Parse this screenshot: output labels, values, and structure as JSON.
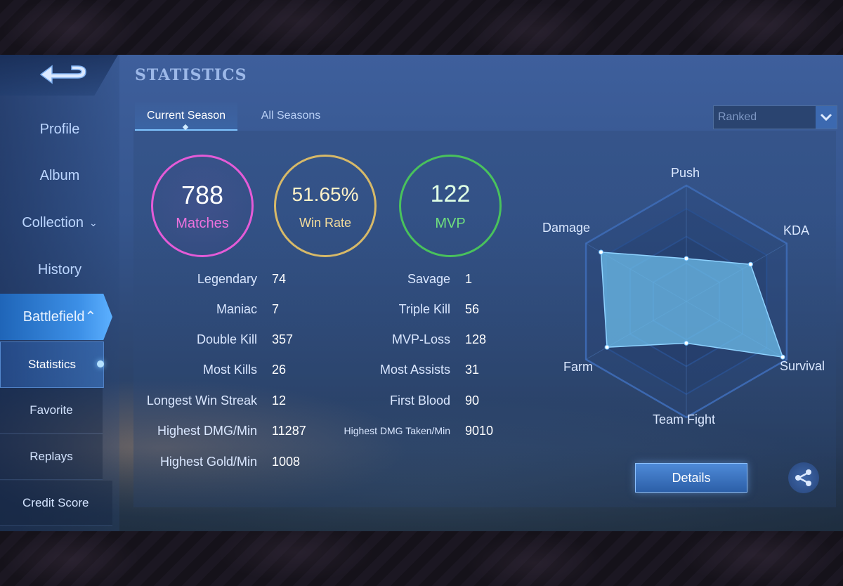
{
  "header": {
    "title": "STATISTICS"
  },
  "sidebar": {
    "items": [
      {
        "label": "Profile"
      },
      {
        "label": "Album"
      },
      {
        "label": "Collection"
      },
      {
        "label": "History"
      },
      {
        "label": "Battlefield"
      }
    ],
    "sub_items": [
      {
        "label": "Statistics"
      },
      {
        "label": "Favorite"
      },
      {
        "label": "Replays"
      },
      {
        "label": "Credit Score"
      }
    ]
  },
  "tabs": {
    "current": "Current Season",
    "all": "All Seasons"
  },
  "mode_select": {
    "value": "Ranked"
  },
  "summary": {
    "matches": {
      "value": "788",
      "label": "Matches"
    },
    "win_rate": {
      "value": "51.65%",
      "label": "Win Rate"
    },
    "mvp": {
      "value": "122",
      "label": "MVP"
    }
  },
  "stats_left": [
    {
      "label": "Legendary",
      "value": "74"
    },
    {
      "label": "Maniac",
      "value": "7"
    },
    {
      "label": "Double Kill",
      "value": "357"
    },
    {
      "label": "Most Kills",
      "value": "26"
    },
    {
      "label": "Longest Win Streak",
      "value": "12"
    },
    {
      "label": "Highest DMG/Min",
      "value": "11287"
    },
    {
      "label": "Highest Gold/Min",
      "value": "1008"
    }
  ],
  "stats_right": [
    {
      "label": "Savage",
      "value": "1"
    },
    {
      "label": "Triple Kill",
      "value": "56"
    },
    {
      "label": "MVP-Loss",
      "value": "128"
    },
    {
      "label": "Most Assists",
      "value": "31"
    },
    {
      "label": "First Blood",
      "value": "90"
    },
    {
      "label": "Highest DMG Taken/Min",
      "value": "9010"
    }
  ],
  "radar": {
    "axes": [
      "Push",
      "KDA",
      "Survival",
      "Team Fight",
      "Farm",
      "Damage"
    ],
    "values": [
      0.37,
      0.64,
      0.96,
      0.36,
      0.79,
      0.85
    ]
  },
  "buttons": {
    "details": "Details"
  },
  "icons": {
    "back": "back-arrow-icon",
    "share": "share-icon",
    "dropdown": "chevron-down-icon"
  },
  "colors": {
    "matches": "#e45bd7",
    "win_rate": "#d7b968",
    "mvp": "#49c25c",
    "accent": "#3c8fe6"
  }
}
